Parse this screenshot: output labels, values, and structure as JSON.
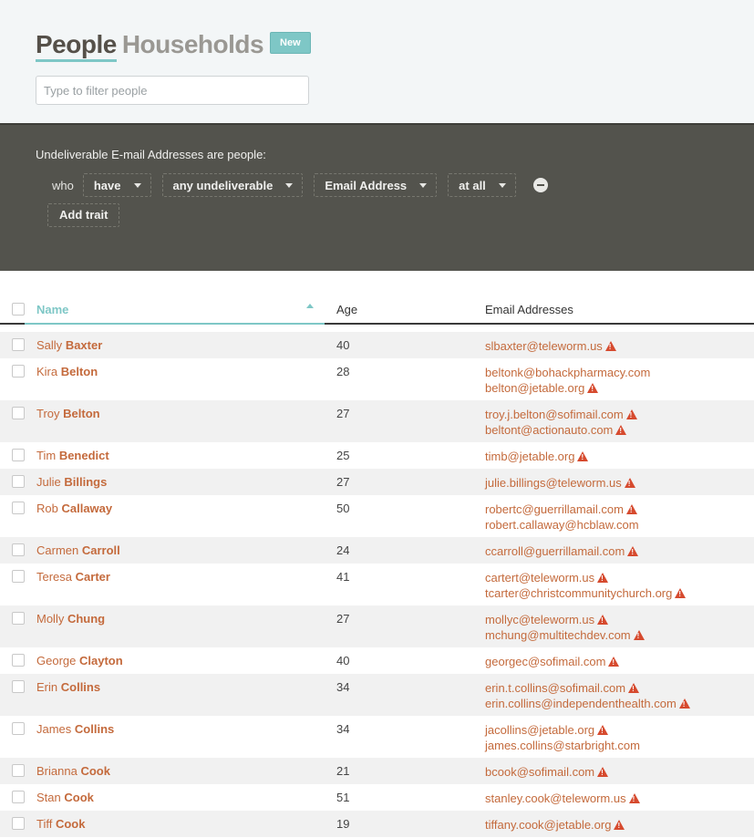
{
  "header": {
    "tab_people": "People",
    "tab_households": "Households",
    "new_label": "New",
    "filter_placeholder": "Type to filter people"
  },
  "filter": {
    "title": "Undeliverable E-mail Addresses are people:",
    "who_label": "who",
    "dropdowns": [
      "have",
      "any undeliverable",
      "Email Address",
      "at all"
    ],
    "add_trait_label": "Add trait"
  },
  "table": {
    "columns": {
      "name": "Name",
      "age": "Age",
      "email": "Email Addresses"
    },
    "sort": {
      "column": "Name",
      "direction": "ascending"
    },
    "rows": [
      {
        "first": "Sally",
        "last": "Baxter",
        "age": "40",
        "emails": [
          {
            "address": "slbaxter@teleworm.us",
            "warning": true
          }
        ]
      },
      {
        "first": "Kira",
        "last": "Belton",
        "age": "28",
        "emails": [
          {
            "address": "beltonk@bohackpharmacy.com",
            "warning": false
          },
          {
            "address": "belton@jetable.org",
            "warning": true
          }
        ]
      },
      {
        "first": "Troy",
        "last": "Belton",
        "age": "27",
        "emails": [
          {
            "address": "troy.j.belton@sofimail.com",
            "warning": true
          },
          {
            "address": "beltont@actionauto.com",
            "warning": true
          }
        ]
      },
      {
        "first": "Tim",
        "last": "Benedict",
        "age": "25",
        "emails": [
          {
            "address": "timb@jetable.org",
            "warning": true
          }
        ]
      },
      {
        "first": "Julie",
        "last": "Billings",
        "age": "27",
        "emails": [
          {
            "address": "julie.billings@teleworm.us",
            "warning": true
          }
        ]
      },
      {
        "first": "Rob",
        "last": "Callaway",
        "age": "50",
        "emails": [
          {
            "address": "robertc@guerrillamail.com",
            "warning": true
          },
          {
            "address": "robert.callaway@hcblaw.com",
            "warning": false
          }
        ]
      },
      {
        "first": "Carmen",
        "last": "Carroll",
        "age": "24",
        "emails": [
          {
            "address": "ccarroll@guerrillamail.com",
            "warning": true
          }
        ]
      },
      {
        "first": "Teresa",
        "last": "Carter",
        "age": "41",
        "emails": [
          {
            "address": "cartert@teleworm.us",
            "warning": true
          },
          {
            "address": "tcarter@christcommunitychurch.org",
            "warning": true
          }
        ]
      },
      {
        "first": "Molly",
        "last": "Chung",
        "age": "27",
        "emails": [
          {
            "address": "mollyc@teleworm.us",
            "warning": true
          },
          {
            "address": "mchung@multitechdev.com",
            "warning": true
          }
        ]
      },
      {
        "first": "George",
        "last": "Clayton",
        "age": "40",
        "emails": [
          {
            "address": "georgec@sofimail.com",
            "warning": true
          }
        ]
      },
      {
        "first": "Erin",
        "last": "Collins",
        "age": "34",
        "emails": [
          {
            "address": "erin.t.collins@sofimail.com",
            "warning": true
          },
          {
            "address": "erin.collins@independenthealth.com",
            "warning": true
          }
        ]
      },
      {
        "first": "James",
        "last": "Collins",
        "age": "34",
        "emails": [
          {
            "address": "jacollins@jetable.org",
            "warning": true
          },
          {
            "address": "james.collins@starbright.com",
            "warning": false
          }
        ]
      },
      {
        "first": "Brianna",
        "last": "Cook",
        "age": "21",
        "emails": [
          {
            "address": "bcook@sofimail.com",
            "warning": true
          }
        ]
      },
      {
        "first": "Stan",
        "last": "Cook",
        "age": "51",
        "emails": [
          {
            "address": "stanley.cook@teleworm.us",
            "warning": true
          }
        ]
      },
      {
        "first": "Tiff",
        "last": "Cook",
        "age": "19",
        "emails": [
          {
            "address": "tiffany.cook@jetable.org",
            "warning": true
          }
        ]
      }
    ]
  },
  "colors": {
    "accent": "#7ec7c6",
    "link": "#c46a3c",
    "warning": "#d64a2e",
    "filterbar": "#53534d"
  },
  "icons": {
    "warning": "warning-triangle-icon",
    "remove": "remove-circle-icon",
    "sort": "sort-asc-icon",
    "caret": "chevron-down-icon"
  }
}
